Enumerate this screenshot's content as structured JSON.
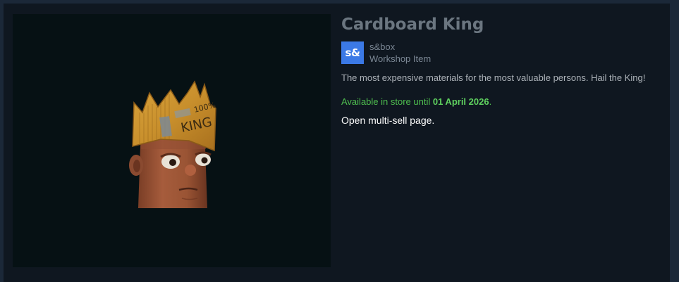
{
  "item": {
    "title": "Cardboard King",
    "app_icon_text": "s&",
    "app_name": "s&box",
    "item_type": "Workshop Item",
    "description": "The most expensive materials for the most valuable persons. Hail the King!",
    "availability_prefix": "Available in store until ",
    "availability_date": "01 April 2026",
    "availability_suffix": ".",
    "multi_sell_link": "Open multi-sell page.",
    "crown_text": "100% KING"
  },
  "colors": {
    "page_background": "#1b2838",
    "panel_background": "#0f1720",
    "image_background": "#061114",
    "title": "#6b7680",
    "app_icon": "#3b79e6",
    "availability": "#4fbf4f",
    "link": "#ffffff"
  }
}
